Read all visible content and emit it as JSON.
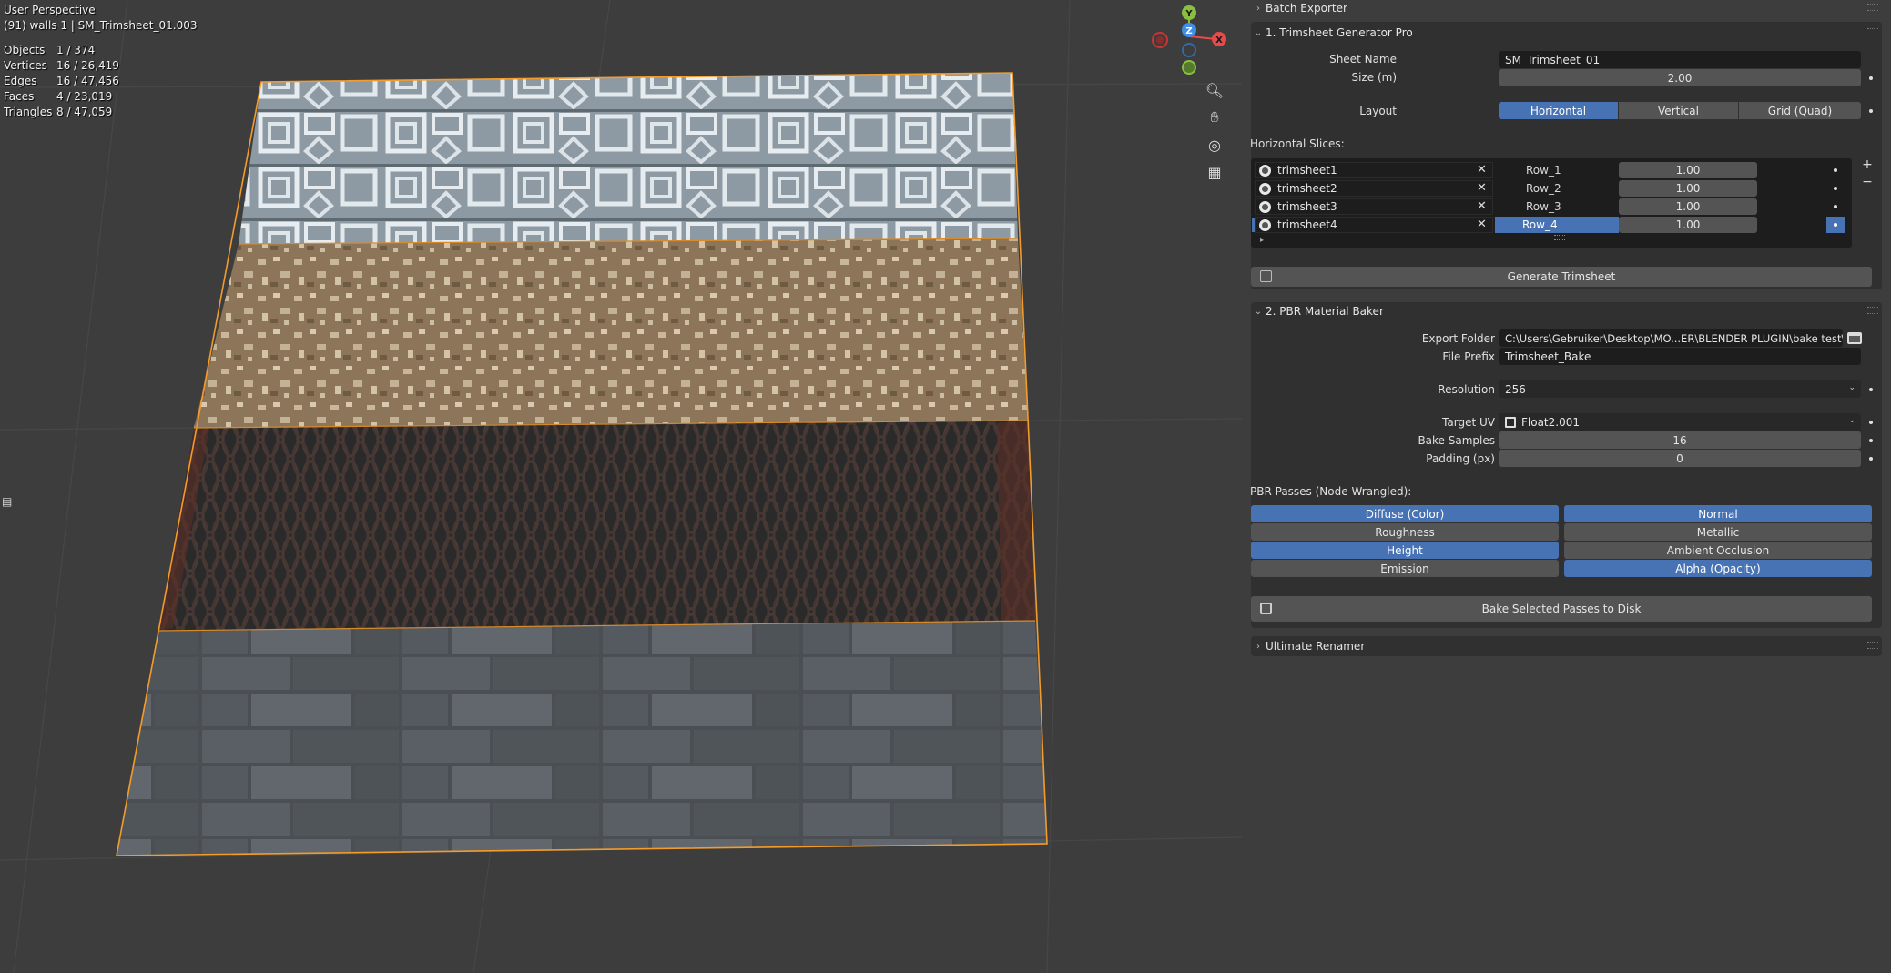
{
  "viewport": {
    "title": "User Perspective",
    "subtitle": "(91) walls 1 | SM_Trimsheet_01.003",
    "stats": [
      {
        "label": "Objects",
        "value": "1 / 374"
      },
      {
        "label": "Vertices",
        "value": "16 / 26,419"
      },
      {
        "label": "Edges",
        "value": "16 / 47,456"
      },
      {
        "label": "Faces",
        "value": "4 / 23,019"
      },
      {
        "label": "Triangles",
        "value": "8 / 47,059"
      }
    ],
    "gizmo": {
      "y": "Y",
      "z": "Z",
      "x": "X"
    },
    "colors": {
      "x_axis": "#e84a4a",
      "y_axis": "#8bbf3f",
      "z_axis": "#3f8fe8",
      "selection": "#f39c2b"
    }
  },
  "panels": {
    "batch_exporter": {
      "title": "Batch Exporter"
    },
    "trimsheet": {
      "title": "1. Trimsheet Generator Pro",
      "sheet_name_label": "Sheet Name",
      "sheet_name_value": "SM_Trimsheet_01",
      "size_label": "Size (m)",
      "size_value": "2.00",
      "layout_label": "Layout",
      "layout_options": [
        "Horizontal",
        "Vertical",
        "Grid (Quad)"
      ],
      "layout_selected": "Horizontal",
      "slices_label": "Horizontal Slices:",
      "slices": [
        {
          "material": "trimsheet1",
          "row": "Row_1",
          "value": "1.00"
        },
        {
          "material": "trimsheet2",
          "row": "Row_2",
          "value": "1.00"
        },
        {
          "material": "trimsheet3",
          "row": "Row_3",
          "value": "1.00"
        },
        {
          "material": "trimsheet4",
          "row": "Row_4",
          "value": "1.00"
        }
      ],
      "add_symbol": "+",
      "remove_symbol": "−",
      "generate_label": "Generate Trimsheet"
    },
    "baker": {
      "title": "2. PBR Material Baker",
      "export_folder_label": "Export Folder",
      "export_folder_value": "C:\\Users\\Gebruiker\\Desktop\\MO...ER\\BLENDER PLUGIN\\bake test\\",
      "file_prefix_label": "File Prefix",
      "file_prefix_value": "Trimsheet_Bake",
      "resolution_label": "Resolution",
      "resolution_value": "256",
      "target_uv_label": "Target UV",
      "target_uv_value": "Float2.001",
      "bake_samples_label": "Bake Samples",
      "bake_samples_value": "16",
      "padding_label": "Padding (px)",
      "padding_value": "0",
      "passes_label": "PBR Passes (Node Wrangled):",
      "passes": [
        {
          "label": "Diffuse (Color)",
          "on": true
        },
        {
          "label": "Normal",
          "on": true
        },
        {
          "label": "Roughness",
          "on": false
        },
        {
          "label": "Metallic",
          "on": false
        },
        {
          "label": "Height",
          "on": true
        },
        {
          "label": "Ambient Occlusion",
          "on": false
        },
        {
          "label": "Emission",
          "on": false
        },
        {
          "label": "Alpha (Opacity)",
          "on": true
        }
      ],
      "bake_button_label": "Bake Selected Passes to Disk"
    },
    "renamer": {
      "title": "Ultimate Renamer"
    }
  }
}
